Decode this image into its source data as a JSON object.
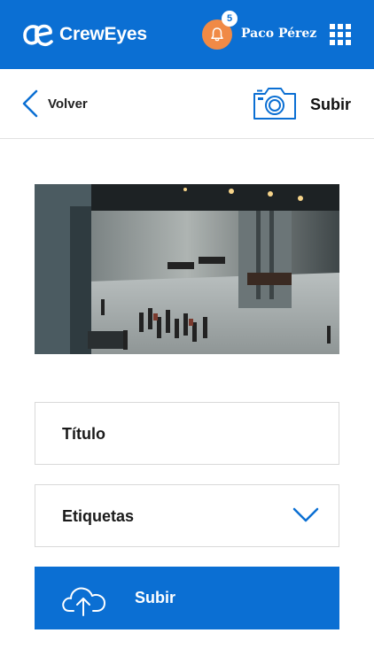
{
  "header": {
    "brand_name": "CrewEyes",
    "notification_count": "5",
    "user_name": "Paco Pérez",
    "colors": {
      "primary": "#0b6fd3",
      "bell": "#f08a46"
    }
  },
  "toolbar": {
    "back_label": "Volver",
    "upload_label": "Subir",
    "icons": {
      "back": "chevron-left-icon",
      "camera": "camera-icon"
    }
  },
  "form": {
    "title_label": "Título",
    "tags_label": "Etiquetas",
    "submit_label": "Subir",
    "icons": {
      "tags_dropdown": "chevron-down-icon",
      "submit": "cloud-upload-icon"
    }
  }
}
